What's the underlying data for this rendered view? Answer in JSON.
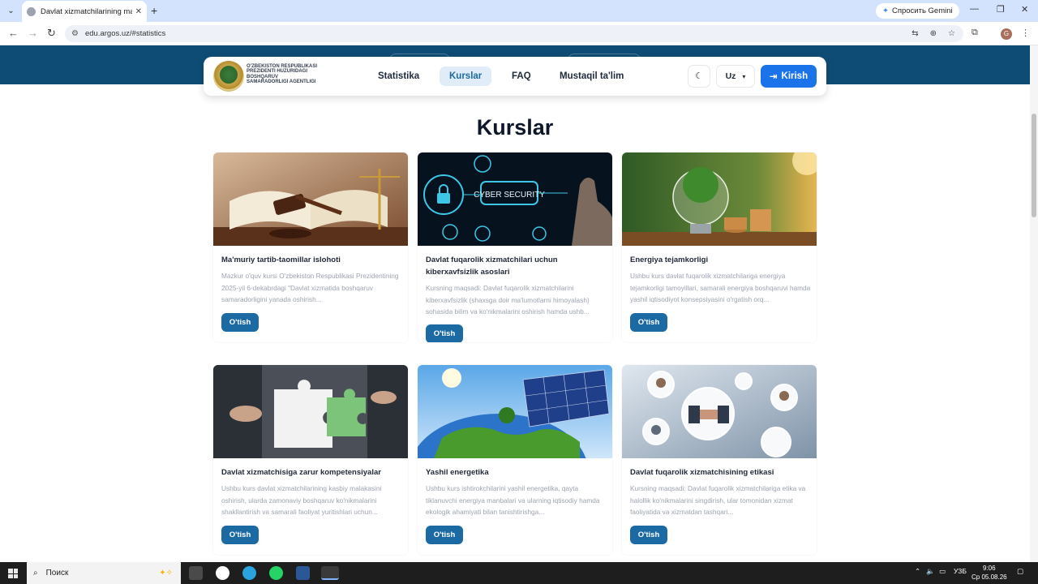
{
  "browser": {
    "tab_title": "Davlat xizmatchilarining malaka",
    "url": "edu.argos.uz/#statistics",
    "gemini_label": "Спросить Gemini",
    "profile_initial": "G"
  },
  "nav": {
    "logo_text": "O'zbekiston Respublikasi Prezidenti huzuridagi Boshqaruv samaradorligi agentligi",
    "links": [
      {
        "label": "Statistika"
      },
      {
        "label": "Kurslar"
      },
      {
        "label": "FAQ"
      },
      {
        "label": "Mustaqil ta'lim"
      }
    ],
    "lang": "Uz",
    "login_label": "Kirish"
  },
  "heading": "Kurslar",
  "courses": [
    {
      "title": "Ma'muriy tartib-taomillar islohoti",
      "desc": "Mazkur o'quv kursi O'zbekiston Respublikasi Prezidentining 2025-yil 6-dekabrdagi \"Davlat xizmatida boshqaruv samaradorligini yanada oshirish...",
      "button": "O'tish",
      "image": "gavel-icon"
    },
    {
      "title": "Davlat fuqarolik xizmatchilari uchun kiberxavfsizlik asoslari",
      "desc": "Kursning maqsadi: Davlat fuqarolik xizmatchilarini kiberxavfsizlik (shaxsga doir ma'lumotlarni himoyalash) sohasida bilim va ko'nikmalarini oshirish hamda ushb...",
      "button": "O'tish",
      "image": "lock-icon",
      "image_text": "CYBER SECURITY"
    },
    {
      "title": "Energiya tejamkorligi",
      "desc": "Ushbu kurs davlat fuqarolik xizmatchilariga energiya tejamkorligi tamoyillari, samarali energiya boshqaruvi hamda yashil iqtisodiyot konsepsiyasini o'rgatish orq...",
      "button": "O'tish",
      "image": "lightbulb-icon"
    },
    {
      "title": "Davlat xizmatchisiga zarur kompetensiyalar",
      "desc": "Ushbu kurs davlat xizmatchilarining kasbiy malakasini oshirish, ularda zamonaviy boshqaruv ko'nikmalarini shakllantirish va samarali faoliyat yuritishlari uchun...",
      "button": "O'tish",
      "image": "puzzle-icon"
    },
    {
      "title": "Yashil energetika",
      "desc": "Ushbu kurs ishtirokchilarini yashil energetika, qayta tiklanuvchi energiya manbalari va ularning iqtisodiy hamda ekologik ahamiyati bilan tanishtirishga...",
      "button": "O'tish",
      "image": "solar-panel-icon"
    },
    {
      "title": "Davlat fuqarolik xizmatchisining etikasi",
      "desc": "Kursning maqsadi: Davlat fuqarolik xizmatchilariga etika va halollik ko'nikmalarini singdirish, ular tomonidan xizmat faoliyatida va xizmatdan tashqari...",
      "button": "O'tish",
      "image": "handshake-icon"
    }
  ],
  "taskbar": {
    "search_label": "Поиск",
    "lang": "УЗБ",
    "time": "9:06",
    "date": "Ср 05.08.26"
  },
  "colors": {
    "hero": "#0f4c75",
    "button": "#1c6aa3",
    "login": "#1a73e8"
  }
}
